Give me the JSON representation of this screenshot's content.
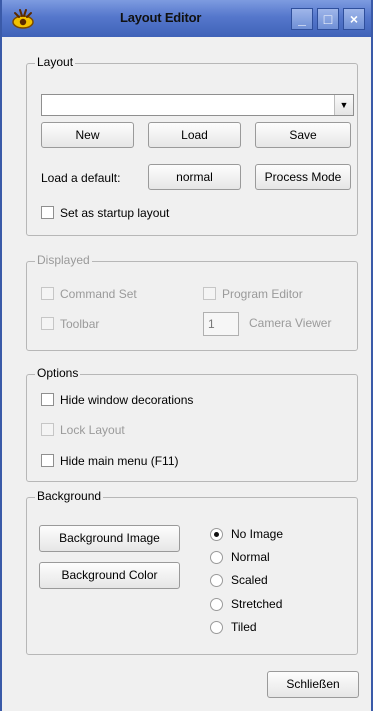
{
  "window": {
    "title": "Layout Editor",
    "controls": {
      "minimize": "_",
      "maximize": "□",
      "close": "×"
    }
  },
  "layout": {
    "group_title": "Layout",
    "combo_value": "",
    "new_label": "New",
    "load_label": "Load",
    "save_label": "Save",
    "load_default_label": "Load a default:",
    "normal_label": "normal",
    "process_mode_label": "Process Mode",
    "startup_label": "Set as startup layout",
    "startup_checked": false
  },
  "displayed": {
    "group_title": "Displayed",
    "command_set": "Command Set",
    "program_editor": "Program Editor",
    "toolbar": "Toolbar",
    "camera_viewer": "Camera Viewer",
    "camera_count": "1"
  },
  "options": {
    "group_title": "Options",
    "hide_window_decorations": "Hide window decorations",
    "lock_layout": "Lock Layout",
    "hide_main_menu": "Hide main menu (F11)"
  },
  "background": {
    "group_title": "Background",
    "image_button": "Background Image",
    "color_button": "Background Color",
    "modes": [
      "No Image",
      "Normal",
      "Scaled",
      "Stretched",
      "Tiled"
    ],
    "selected_mode": "No Image"
  },
  "footer": {
    "close_label": "Schließen"
  },
  "colors": {
    "title_bar": "#5577cc",
    "window_bg": "#f0f0f0"
  }
}
